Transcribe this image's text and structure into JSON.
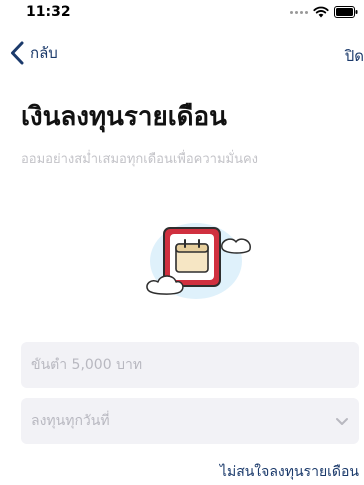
{
  "status_bar": {
    "time": "11:32",
    "icons": [
      "signal-dots-icon",
      "wifi-icon",
      "battery-icon"
    ]
  },
  "nav": {
    "back_label": "กลับ",
    "close_label": "ปิด"
  },
  "title": "เงินลงทุนรายเดือน",
  "subtitle": "ออมอย่างสม่ำเสมอทุกเดือนเพื่อความมั่นคง",
  "illustration": {
    "icon": "calendar-icon",
    "decor": [
      "cloud-icon"
    ]
  },
  "form": {
    "amount_placeholder": "ขั้นต่ำ 5,000 บาท",
    "amount_value": "",
    "day_placeholder": "ลงทุนทุกวันที่",
    "day_icon": "chevron-down-icon"
  },
  "skip_label": "ไม่สนใจลงทุนรายเดือน",
  "colors": {
    "accent": "#1b3a6b",
    "title": "#111111",
    "subtitle": "#c3c3c8",
    "field_bg": "#f2f2f6",
    "calendar_frame": "#d0303f",
    "calendar_body": "#f6e6c4",
    "sky": "#dff1fb"
  }
}
